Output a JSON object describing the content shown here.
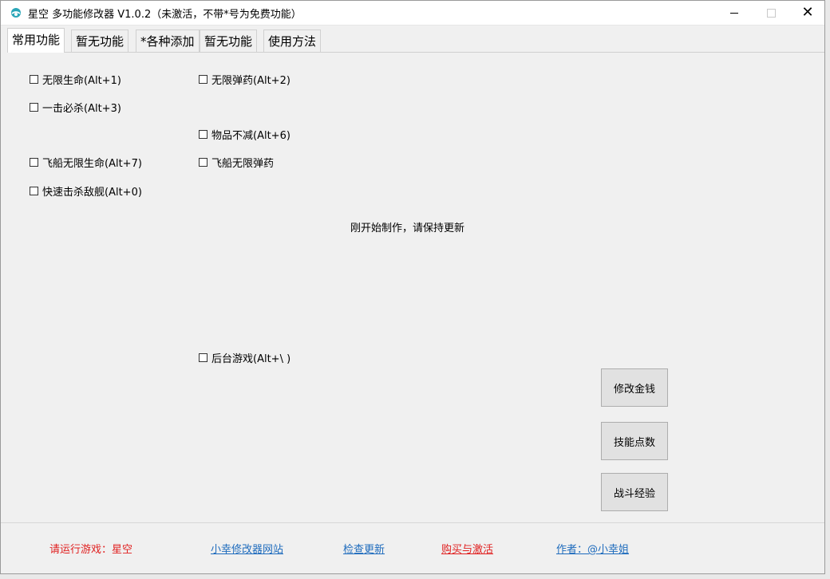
{
  "window": {
    "title": "星空 多功能修改器  V1.0.2（未激活，不带*号为免费功能）"
  },
  "tabs": [
    {
      "label": "常用功能"
    },
    {
      "label": "暂无功能"
    },
    {
      "label": "*各种添加"
    },
    {
      "label": "暂无功能"
    },
    {
      "label": "使用方法"
    }
  ],
  "checkboxes": [
    {
      "label": "无限生命(Alt+1)",
      "checked": false
    },
    {
      "label": "无限弹药(Alt+2)",
      "checked": false
    },
    {
      "label": "一击必杀(Alt+3)",
      "checked": false
    },
    {
      "label": "物品不减(Alt+6)",
      "checked": false
    },
    {
      "label": "飞船无限生命(Alt+7)",
      "checked": false
    },
    {
      "label": "飞船无限弹药",
      "checked": false
    },
    {
      "label": "快速击杀敌舰(Alt+0)",
      "checked": false
    },
    {
      "label": "后台游戏(Alt+\\ )",
      "checked": false
    }
  ],
  "notice": "刚开始制作，请保持更新",
  "buttons": [
    {
      "label": "修改金钱"
    },
    {
      "label": "技能点数"
    },
    {
      "label": "战斗经验"
    }
  ],
  "status": {
    "game_prompt": "请运行游戏：星空",
    "site_link": "小幸修改器网站",
    "update_link": "检查更新",
    "buy_link": "购买与激活",
    "author_link": "作者：@小幸姐"
  },
  "colors": {
    "accent_red": "#e02020",
    "link_blue": "#1e6bbd"
  }
}
